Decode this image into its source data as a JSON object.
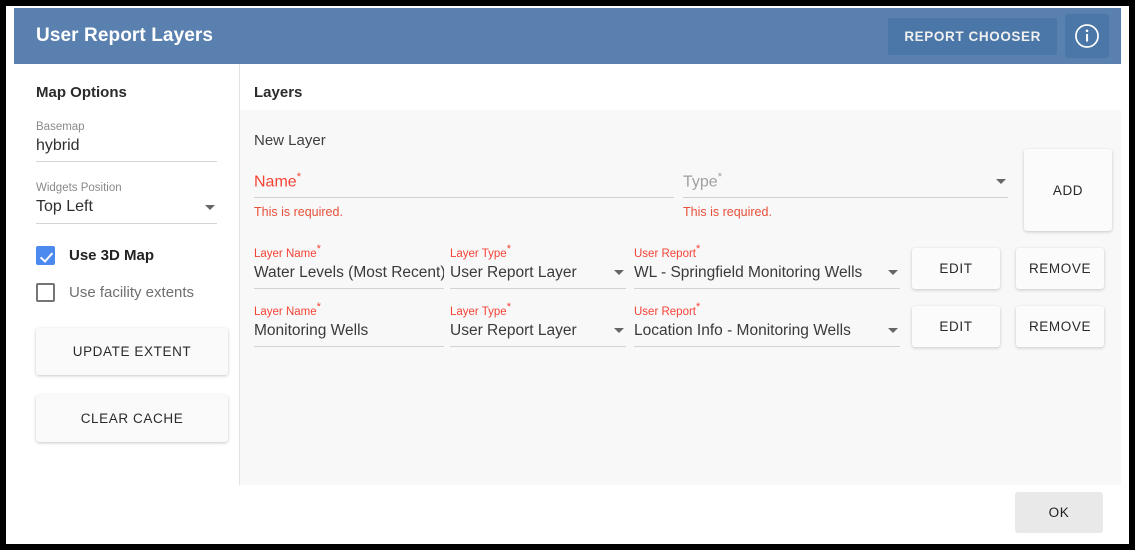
{
  "header": {
    "title": "User Report Layers",
    "report_chooser_label": "REPORT CHOOSER",
    "info_icon": "info-circle-icon",
    "bg_color": "#5a80b0",
    "button_color": "#4a76a8"
  },
  "sidebar": {
    "title": "Map Options",
    "basemap": {
      "label": "Basemap",
      "value": "hybrid"
    },
    "widgets_position": {
      "label": "Widgets Position",
      "value": "Top Left",
      "caret_icon": "chevron-down-icon"
    },
    "checkboxes": [
      {
        "label": "Use 3D Map",
        "checked": true
      },
      {
        "label": "Use facility extents",
        "checked": false
      }
    ],
    "buttons": [
      {
        "label": "UPDATE EXTENT"
      },
      {
        "label": "CLEAR CACHE"
      }
    ],
    "accent_color": "#4d8af0"
  },
  "main": {
    "title": "Layers",
    "new_layer": {
      "section_label": "New Layer",
      "name_field": {
        "placeholder": "Name",
        "required_mark": "*",
        "value": "",
        "error": "This is required."
      },
      "type_field": {
        "placeholder": "Type",
        "required_mark": "*",
        "value": "",
        "error": "This is required.",
        "caret_icon": "chevron-down-icon"
      },
      "add_label": "ADD"
    },
    "column_labels": {
      "layer_name": "Layer Name",
      "layer_type": "Layer Type",
      "user_report": "User Report",
      "required_mark": "*"
    },
    "rows": [
      {
        "layer_name": "Water Levels (Most Recent)",
        "layer_type": "User Report Layer",
        "user_report": "WL - Springfield Monitoring Wells",
        "edit_label": "EDIT",
        "remove_label": "REMOVE"
      },
      {
        "layer_name": "Monitoring Wells",
        "layer_type": "User Report Layer",
        "user_report": "Location Info - Monitoring Wells",
        "edit_label": "EDIT",
        "remove_label": "REMOVE"
      }
    ],
    "error_color": "#e8503a",
    "required_color": "#f44336"
  },
  "footer": {
    "ok_label": "OK"
  }
}
